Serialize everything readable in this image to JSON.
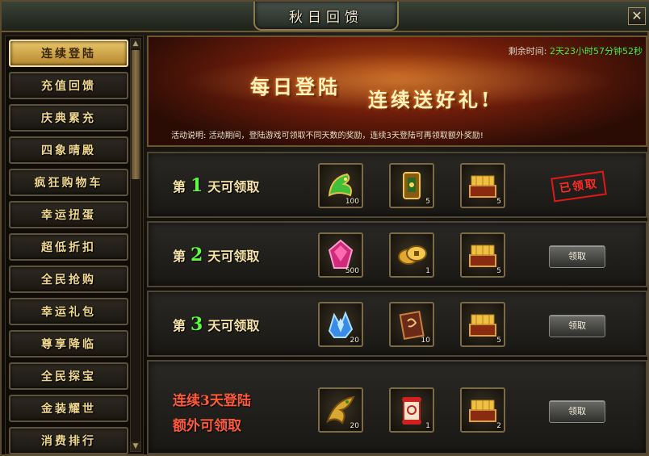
{
  "window": {
    "title": "秋日回馈",
    "close_symbol": "✕"
  },
  "sidebar": {
    "items": [
      {
        "label": "连续登陆",
        "active": true
      },
      {
        "label": "充值回馈"
      },
      {
        "label": "庆典累充"
      },
      {
        "label": "四象晴殿"
      },
      {
        "label": "疯狂购物车"
      },
      {
        "label": "幸运扭蛋"
      },
      {
        "label": "超低折扣"
      },
      {
        "label": "全民抢购"
      },
      {
        "label": "幸运礼包"
      },
      {
        "label": "尊享降临"
      },
      {
        "label": "全民探宝"
      },
      {
        "label": "金装耀世"
      },
      {
        "label": "消费排行"
      }
    ]
  },
  "banner": {
    "remaining_label": "剩余时间:",
    "remaining_value": "2天23小时57分钟52秒",
    "title_1": "每日登陆",
    "title_2": "连续送好礼!",
    "desc_label": "活动说明:",
    "desc_text": "活动期间，登陆游戏可领取不同天数的奖励，连续3天登陆可再领取额外奖励!"
  },
  "rows": [
    {
      "prefix": "第",
      "day": "1",
      "suffix": "天可领取",
      "items": [
        {
          "icon": "green-dragon-icon",
          "count": "100"
        },
        {
          "icon": "golden-token-icon",
          "count": "5"
        },
        {
          "icon": "gold-chest-icon",
          "count": "5"
        }
      ],
      "status": "claimed",
      "stamp": "已领取"
    },
    {
      "prefix": "第",
      "day": "2",
      "suffix": "天可领取",
      "items": [
        {
          "icon": "magenta-gem-icon",
          "count": "500"
        },
        {
          "icon": "gold-coin-icon",
          "count": "1"
        },
        {
          "icon": "gold-chest-icon",
          "count": "5"
        }
      ],
      "button": "领取"
    },
    {
      "prefix": "第",
      "day": "3",
      "suffix": "天可领取",
      "items": [
        {
          "icon": "blue-crystal-icon",
          "count": "20"
        },
        {
          "icon": "rune-book-icon",
          "count": "10"
        },
        {
          "icon": "gold-chest-icon",
          "count": "5"
        }
      ],
      "button": "领取"
    }
  ],
  "extra_row": {
    "line1": "连续3天登陆",
    "line2": "额外可领取",
    "items": [
      {
        "icon": "gold-dragon-wing-icon",
        "count": "20"
      },
      {
        "icon": "red-scroll-icon",
        "count": "1"
      },
      {
        "icon": "gold-chest-icon",
        "count": "2"
      }
    ],
    "button": "领取"
  },
  "colors": {
    "gold_text": "#f0d890",
    "day_number": "#5cff3c",
    "timer_green": "#3cf03c",
    "extra_red": "#ff5a3a",
    "stamp_red": "#e01818"
  }
}
